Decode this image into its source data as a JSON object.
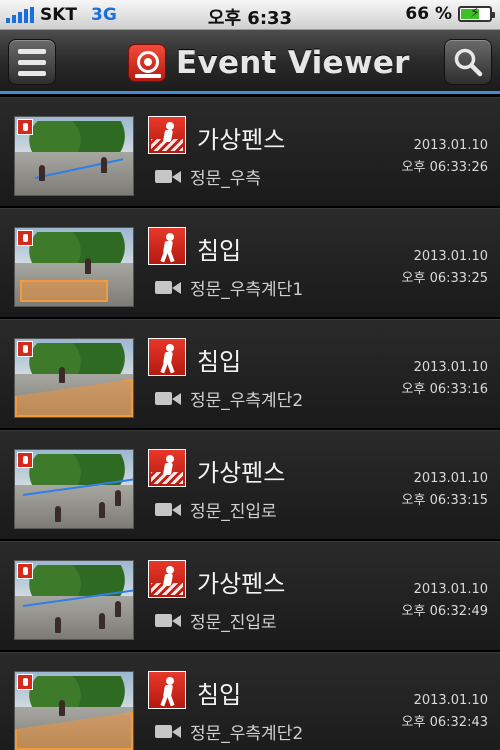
{
  "status_bar": {
    "carrier": "SKT",
    "network": "3G",
    "time": "오후 6:33",
    "battery_percent": "66 %",
    "battery_level": 0.66,
    "battery_charging_symbol": "⚡"
  },
  "nav": {
    "menu_icon": "hamburger-menu-icon",
    "title": "Event Viewer",
    "logo_icon": "event-viewer-app-icon",
    "search_icon": "search-icon"
  },
  "events": [
    {
      "type": "가상펜스",
      "kind": "fence",
      "location": "정문_우측",
      "date": "2013.01.10",
      "time": "오후 06:33:26",
      "thumb": "street"
    },
    {
      "type": "침입",
      "kind": "intrusion",
      "location": "정문_우측계단1",
      "date": "2013.01.10",
      "time": "오후 06:33:25",
      "thumb": "stairs"
    },
    {
      "type": "침입",
      "kind": "intrusion",
      "location": "정문_우측계단2",
      "date": "2013.01.10",
      "time": "오후 06:33:16",
      "thumb": "ramp"
    },
    {
      "type": "가상펜스",
      "kind": "fence",
      "location": "정문_진입로",
      "date": "2013.01.10",
      "time": "오후 06:33:15",
      "thumb": "road"
    },
    {
      "type": "가상펜스",
      "kind": "fence",
      "location": "정문_진입로",
      "date": "2013.01.10",
      "time": "오후 06:32:49",
      "thumb": "road"
    },
    {
      "type": "침입",
      "kind": "intrusion",
      "location": "정문_우측계단2",
      "date": "2013.01.10",
      "time": "오후 06:32:43",
      "thumb": "ramp"
    }
  ],
  "colors": {
    "accent": "#3c8fd4",
    "event_red": "#d42a1c",
    "zone_orange": "#f29a3a"
  }
}
